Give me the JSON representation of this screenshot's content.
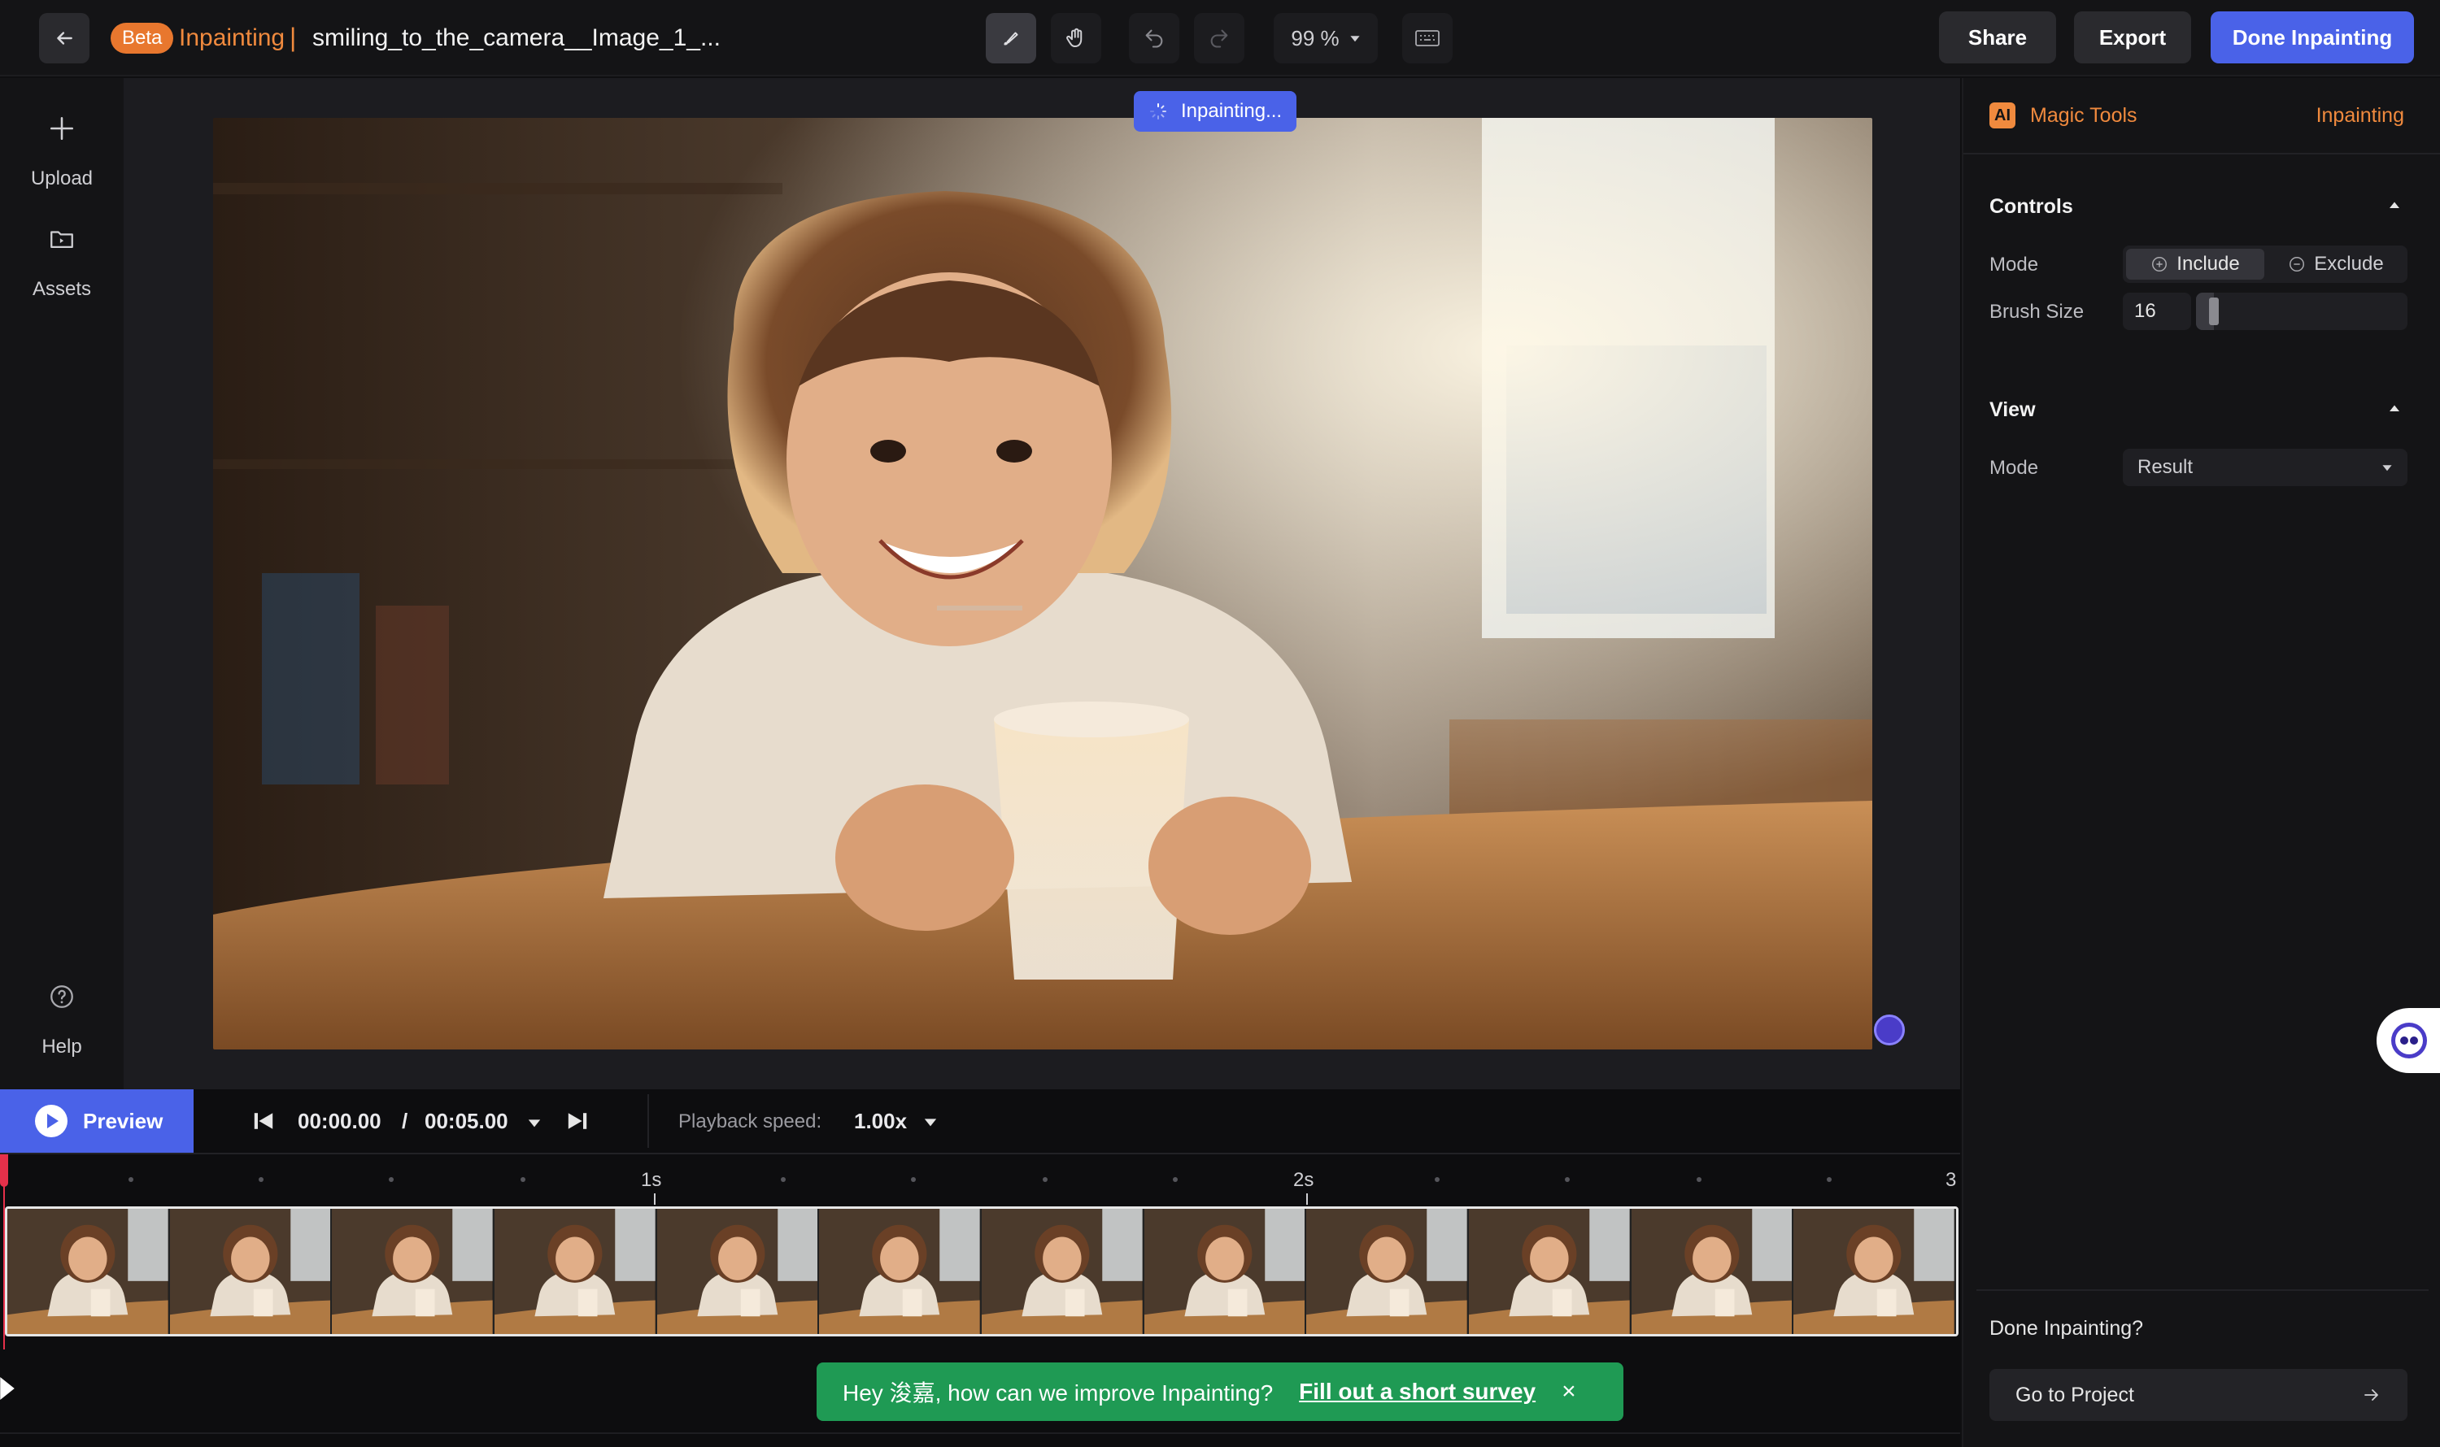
{
  "header": {
    "beta_badge": "Beta",
    "mode_title": "Inpainting",
    "separator": "|",
    "file_name": "smiling_to_the_camera__Image_1_...",
    "zoom": "99 %",
    "share_label": "Share",
    "export_label": "Export",
    "done_label": "Done Inpainting"
  },
  "sidebar": {
    "items": [
      {
        "label": "Upload",
        "icon": "plus-icon"
      },
      {
        "label": "Assets",
        "icon": "folder-icon"
      },
      {
        "label": "Help",
        "icon": "question-icon"
      }
    ]
  },
  "canvas": {
    "status": "Inpainting..."
  },
  "panel": {
    "ai_badge": "AI",
    "tools_label": "Magic Tools",
    "tool_active": "Inpainting",
    "controls_title": "Controls",
    "mode_label": "Mode",
    "include_label": "Include",
    "exclude_label": "Exclude",
    "brush_label": "Brush Size",
    "brush_value": "16",
    "brush_fraction": 0.06,
    "view_title": "View",
    "view_mode_label": "Mode",
    "view_mode_value": "Result",
    "done_question": "Done Inpainting?",
    "goto_label": "Go to Project"
  },
  "timeline": {
    "preview_label": "Preview",
    "current_time": "00:00.00",
    "time_sep": "/",
    "total_time": "00:05.00",
    "speed_label": "Playback speed:",
    "speed_value": "1.00x",
    "ruler_labels": [
      "1s",
      "2s",
      "3"
    ]
  },
  "survey": {
    "text": "Hey 浚嘉, how can we improve Inpainting?",
    "link": "Fill out a short survey",
    "close": "×"
  },
  "colors": {
    "accent": "#4a62e8",
    "orange": "#e8772e",
    "survey_green": "#1f9a54"
  }
}
